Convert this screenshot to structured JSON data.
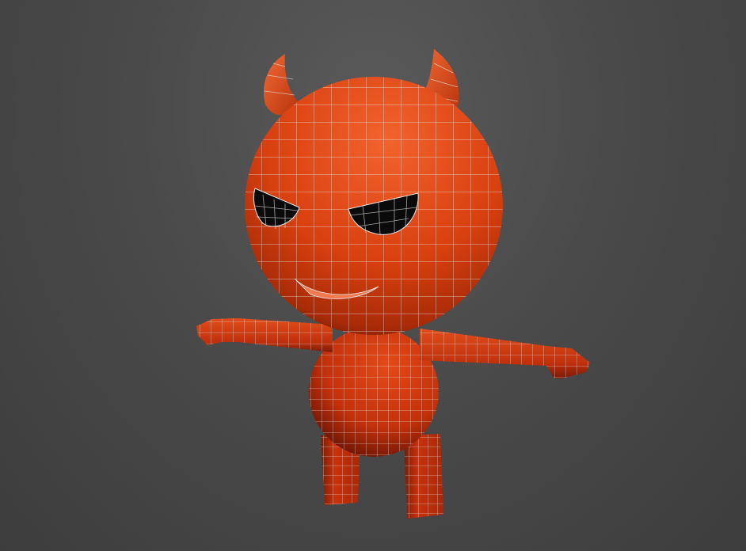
{
  "viewport": {
    "background_top": "#5a5a5a",
    "background_bottom": "#3d3d3d",
    "wireframe_color": "#e8e8e8"
  },
  "model": {
    "icon": "devil-character-wireframe",
    "body_color": "#d83a14",
    "body_highlight": "#f0602c",
    "body_shadow": "#7a1a06",
    "eye_color": "#0a0a0a",
    "mouth_color": "#f07a52"
  }
}
